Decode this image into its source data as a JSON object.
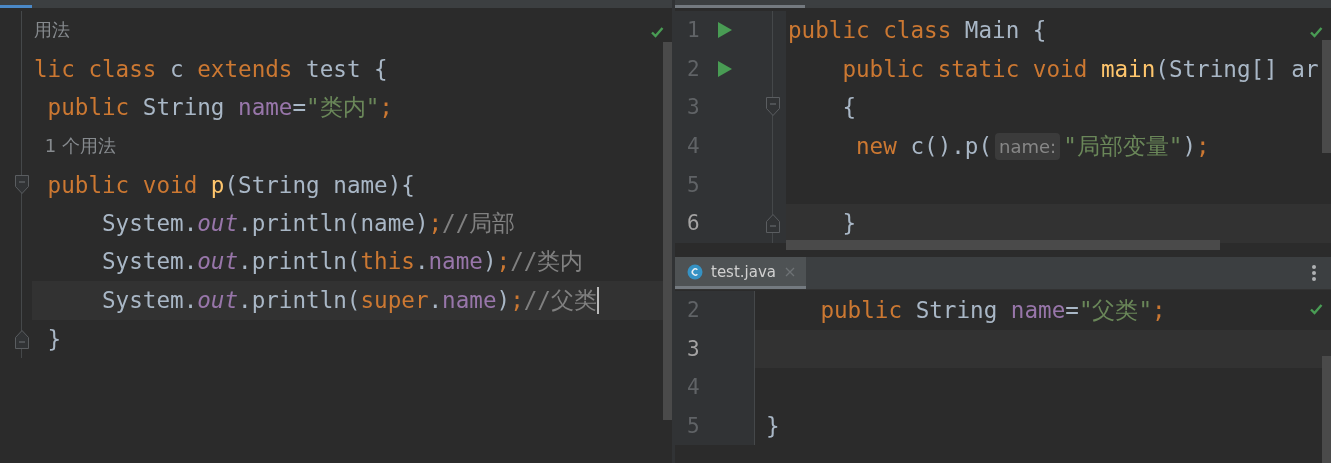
{
  "left_editor": {
    "lines": [
      {
        "kind": "hint",
        "text": "用法"
      },
      {
        "kind": "code",
        "current": false,
        "caret": false,
        "tokens": [
          {
            "kind": "keyword",
            "text": "lic class "
          },
          {
            "kind": "plain",
            "text": "c "
          },
          {
            "kind": "keyword",
            "text": "extends "
          },
          {
            "kind": "plain",
            "text": "test {"
          }
        ]
      },
      {
        "kind": "code",
        "current": false,
        "caret": false,
        "tokens": [
          {
            "kind": "keyword",
            "text": " public "
          },
          {
            "kind": "plain",
            "text": "String "
          },
          {
            "kind": "field",
            "text": "name"
          },
          {
            "kind": "plain",
            "text": "="
          },
          {
            "kind": "string",
            "text": "\"类内\""
          },
          {
            "kind": "punct",
            "text": ";"
          }
        ]
      },
      {
        "kind": "hint",
        "text": "1 个用法"
      },
      {
        "kind": "code",
        "current": false,
        "caret": false,
        "fold_start": true,
        "fold_end": false,
        "tokens": [
          {
            "kind": "keyword",
            "text": " public void "
          },
          {
            "kind": "method",
            "text": "p"
          },
          {
            "kind": "plain",
            "text": "(String name){"
          }
        ]
      },
      {
        "kind": "code",
        "current": false,
        "caret": false,
        "tokens": [
          {
            "kind": "plain",
            "text": "     System."
          },
          {
            "kind": "static",
            "text": "out"
          },
          {
            "kind": "plain",
            "text": ".println(name)"
          },
          {
            "kind": "punct",
            "text": ";"
          },
          {
            "kind": "comment",
            "text": "//局部"
          }
        ]
      },
      {
        "kind": "code",
        "current": false,
        "caret": false,
        "tokens": [
          {
            "kind": "plain",
            "text": "     System."
          },
          {
            "kind": "static",
            "text": "out"
          },
          {
            "kind": "plain",
            "text": ".println("
          },
          {
            "kind": "keyword",
            "text": "this"
          },
          {
            "kind": "plain",
            "text": "."
          },
          {
            "kind": "field",
            "text": "name"
          },
          {
            "kind": "plain",
            "text": ")"
          },
          {
            "kind": "punct",
            "text": ";"
          },
          {
            "kind": "comment",
            "text": "//类内"
          }
        ]
      },
      {
        "kind": "code",
        "current": true,
        "caret": true,
        "tokens": [
          {
            "kind": "plain",
            "text": "     System."
          },
          {
            "kind": "static",
            "text": "out"
          },
          {
            "kind": "plain",
            "text": ".println("
          },
          {
            "kind": "keyword",
            "text": "super"
          },
          {
            "kind": "plain",
            "text": "."
          },
          {
            "kind": "field",
            "text": "name"
          },
          {
            "kind": "plain",
            "text": ")"
          },
          {
            "kind": "punct",
            "text": ";"
          },
          {
            "kind": "comment",
            "text": "//父类"
          }
        ]
      },
      {
        "kind": "code",
        "current": false,
        "caret": false,
        "fold_start": false,
        "fold_end": true,
        "tokens": [
          {
            "kind": "plain",
            "text": " }"
          }
        ]
      }
    ]
  },
  "main_editor": {
    "lines": [
      {
        "number": "1",
        "run": true,
        "current": false,
        "tokens": [
          {
            "kind": "keyword",
            "text": "public class "
          },
          {
            "kind": "plain",
            "text": "Main {"
          }
        ]
      },
      {
        "number": "2",
        "run": true,
        "current": false,
        "tokens": [
          {
            "kind": "keyword",
            "text": "    public static void "
          },
          {
            "kind": "method",
            "text": "main"
          },
          {
            "kind": "plain",
            "text": "(String[] ar"
          }
        ]
      },
      {
        "number": "3",
        "run": false,
        "current": false,
        "fold_start": true,
        "fold_end": false,
        "tokens": [
          {
            "kind": "plain",
            "text": "    {"
          }
        ]
      },
      {
        "number": "4",
        "run": false,
        "current": false,
        "tokens": [
          {
            "kind": "keyword",
            "text": "     new "
          },
          {
            "kind": "plain",
            "text": "c().p("
          },
          {
            "kind": "param_hint",
            "text": "name:"
          },
          {
            "kind": "string",
            "text": "\"局部变量\""
          },
          {
            "kind": "plain",
            "text": ")"
          },
          {
            "kind": "punct",
            "text": ";"
          }
        ]
      },
      {
        "number": "5",
        "run": false,
        "current": false
      },
      {
        "number": "6",
        "run": false,
        "current": true,
        "fold_start": false,
        "fold_end": true,
        "tokens": [
          {
            "kind": "plain",
            "text": "    }"
          }
        ]
      }
    ]
  },
  "bottom_editor": {
    "tabs": [
      {
        "label": "test.java",
        "selected": true
      }
    ],
    "lines": [
      {
        "number": "2",
        "current": false,
        "tokens": [
          {
            "kind": "keyword",
            "text": "    public "
          },
          {
            "kind": "plain",
            "text": "String "
          },
          {
            "kind": "field",
            "text": "name"
          },
          {
            "kind": "plain",
            "text": "="
          },
          {
            "kind": "string",
            "text": "\"父类\""
          },
          {
            "kind": "punct",
            "text": ";"
          }
        ]
      },
      {
        "number": "3",
        "current": true
      },
      {
        "number": "4",
        "current": false
      },
      {
        "number": "5",
        "current": false,
        "tokens": [
          {
            "kind": "plain",
            "text": "}"
          }
        ]
      }
    ]
  }
}
